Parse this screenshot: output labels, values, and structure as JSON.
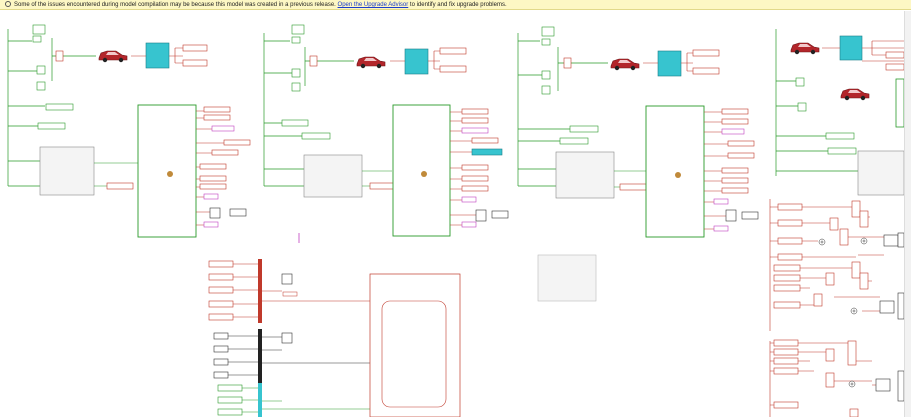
{
  "banner": {
    "prefix": "Some of the issues encountered during model compilation may be because this model was created in a previous release.",
    "link": "Open the Upgrade Advisor",
    "suffix": "to identify and fix upgrade problems."
  },
  "icons": {
    "info": "info-icon",
    "vehicle": "car-icon",
    "scope": "scope-icon"
  },
  "colors": {
    "green_signal": "#2a9a2a",
    "red_signal": "#c0392b",
    "magenta_signal": "#c040c0",
    "cyan_block": "#37c4cf",
    "banner_bg": "#fdf7c4"
  }
}
